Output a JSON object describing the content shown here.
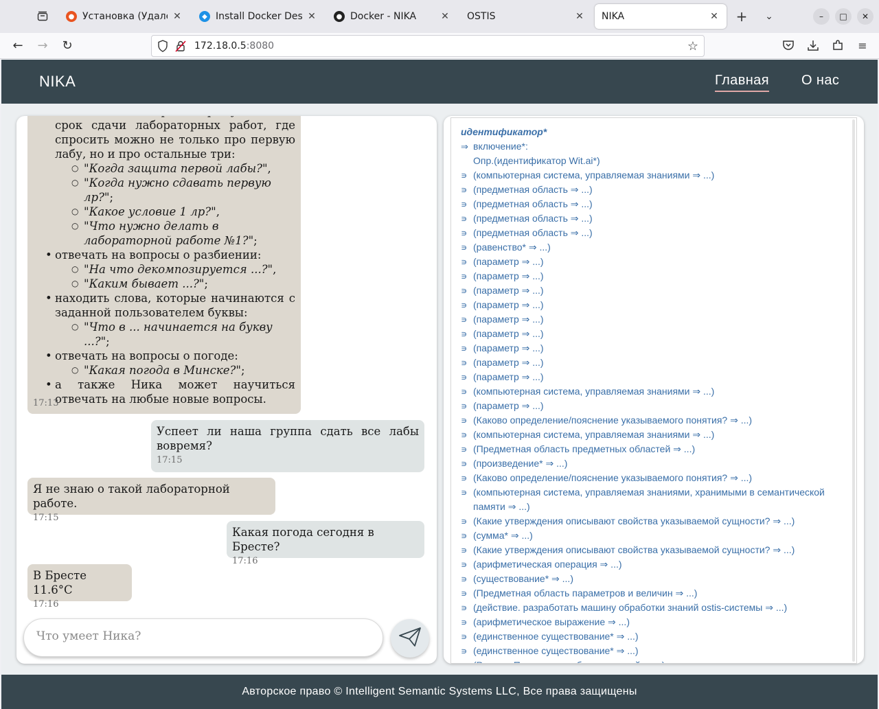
{
  "browser": {
    "tabs": [
      {
        "title": "Установка (Удаленн",
        "favicon": "ubuntu-icon",
        "active": false
      },
      {
        "title": "Install Docker Deskt",
        "favicon": "docker-icon",
        "active": false
      },
      {
        "title": "Docker - NIKA",
        "favicon": "github-icon",
        "active": false
      },
      {
        "title": "OSTIS",
        "favicon": "none",
        "active": false
      },
      {
        "title": "NIKA",
        "favicon": "none",
        "active": true
      }
    ],
    "url_host": "172.18.0.5",
    "url_port": ":8080"
  },
  "site": {
    "brand": "NIKA",
    "nav": {
      "home": "Главная",
      "about": "О нас"
    },
    "footer": "Авторское право © Intelligent Semantic Systems LLC, Все права защищены"
  },
  "chat": {
    "big_message": {
      "items": [
        {
          "level": 1,
          "text": "отвечать на вопросы про условия и срок сдачи лабораторных работ, где спросить можно не только про первую лабу, но и про остальные три:"
        },
        {
          "level": 2,
          "text": "\"Когда защита первой лабы?\"",
          "tail": ","
        },
        {
          "level": 2,
          "text": "\"Когда нужно сдавать первую лр?\"",
          "tail": ";"
        },
        {
          "level": 2,
          "text": "\"Какое условие 1 лр?\"",
          "tail": ","
        },
        {
          "level": 2,
          "text": "\"Что нужно делать в лабораторной работе №1?\"",
          "tail": ";"
        },
        {
          "level": 1,
          "text": "отвечать на вопросы о разбиении:"
        },
        {
          "level": 2,
          "text": "\"На что декомпозируется ...?\"",
          "tail": ","
        },
        {
          "level": 2,
          "text": "\"Каким бывает ...?\"",
          "tail": ";"
        },
        {
          "level": 1,
          "text": "находить слова, которые начинаются с заданной пользователем буквы:"
        },
        {
          "level": 2,
          "text": "\"Что в ... начинается на букву ...?\"",
          "tail": ";"
        },
        {
          "level": 1,
          "text": "отвечать на вопросы о погоде:"
        },
        {
          "level": 2,
          "text": "\"Какая погода в Минске?\"",
          "tail": ";"
        },
        {
          "level": 1,
          "text": "а также Ника может научиться отвечать на любые новые вопросы."
        }
      ],
      "time": "17:13"
    },
    "messages": [
      {
        "from": "user",
        "text": "Успеет ли наша группа сдать все лабы вовремя?",
        "time": "17:15"
      },
      {
        "from": "bot",
        "text": "Я не знаю о такой лабораторной работе.",
        "time": "17:15"
      },
      {
        "from": "user",
        "text": "Какая погода сегодня в Бресте?",
        "time": "17:16"
      },
      {
        "from": "bot",
        "text": "В Бресте 11.6°C",
        "time": "17:16"
      }
    ],
    "input_placeholder": "Что умеет Ника?"
  },
  "kb": {
    "title": "идентификатор*",
    "rows": [
      {
        "arrow": "⇒",
        "text": "включение*:"
      },
      {
        "arrow": "",
        "text": "Опр.(идентификатор Wit.ai*)"
      },
      {
        "arrow": "∍",
        "text": "(компьютерная система, управляемая знаниями ⇒ ...)"
      },
      {
        "arrow": "∍",
        "text": "(предметная область ⇒ ...)"
      },
      {
        "arrow": "∍",
        "text": "(предметная область ⇒ ...)"
      },
      {
        "arrow": "∍",
        "text": "(предметная область ⇒ ...)"
      },
      {
        "arrow": "∍",
        "text": "(предметная область ⇒ ...)"
      },
      {
        "arrow": "∍",
        "text": "(равенство* ⇒ ...)"
      },
      {
        "arrow": "∍",
        "text": "(параметр ⇒ ...)"
      },
      {
        "arrow": "∍",
        "text": "(параметр ⇒ ...)"
      },
      {
        "arrow": "∍",
        "text": "(параметр ⇒ ...)"
      },
      {
        "arrow": "∍",
        "text": "(параметр ⇒ ...)"
      },
      {
        "arrow": "∍",
        "text": "(параметр ⇒ ...)"
      },
      {
        "arrow": "∍",
        "text": "(параметр ⇒ ...)"
      },
      {
        "arrow": "∍",
        "text": "(параметр ⇒ ...)"
      },
      {
        "arrow": "∍",
        "text": "(параметр ⇒ ...)"
      },
      {
        "arrow": "∍",
        "text": "(параметр ⇒ ...)"
      },
      {
        "arrow": "∍",
        "text": "(компьютерная система, управляемая знаниями ⇒ ...)"
      },
      {
        "arrow": "∍",
        "text": "(параметр ⇒ ...)"
      },
      {
        "arrow": "∍",
        "text": "(Каково определение/пояснение указываемого понятия? ⇒ ...)"
      },
      {
        "arrow": "∍",
        "text": "(компьютерная система, управляемая знаниями ⇒ ...)"
      },
      {
        "arrow": "∍",
        "text": "(Предметная область предметных областей ⇒ ...)"
      },
      {
        "arrow": "∍",
        "text": "(произведение* ⇒ ...)"
      },
      {
        "arrow": "∍",
        "text": "(Каково определение/пояснение указываемого понятия? ⇒ ...)"
      },
      {
        "arrow": "∍",
        "text": "(компьютерная система, управляемая знаниями, хранимыми в семантической"
      },
      {
        "arrow": "",
        "text": "памяти ⇒ ...)"
      },
      {
        "arrow": "∍",
        "text": "(Какие утверждения описывают свойства указываемой сущности? ⇒ ...)"
      },
      {
        "arrow": "∍",
        "text": "(сумма* ⇒ ...)"
      },
      {
        "arrow": "∍",
        "text": "(Какие утверждения описывают свойства указываемой сущности? ⇒ ...)"
      },
      {
        "arrow": "∍",
        "text": "(арифметическая операция ⇒ ...)"
      },
      {
        "arrow": "∍",
        "text": "(существование* ⇒ ...)"
      },
      {
        "arrow": "∍",
        "text": "(Предметная область параметров и величин ⇒ ...)"
      },
      {
        "arrow": "∍",
        "text": "(действие. разработать машину обработки знаний ostis-системы ⇒ ...)"
      },
      {
        "arrow": "∍",
        "text": "(арифметическое выражение ⇒ ...)"
      },
      {
        "arrow": "∍",
        "text": "(единственное существование* ⇒ ...)"
      },
      {
        "arrow": "∍",
        "text": "(единственное существование* ⇒ ...)"
      },
      {
        "arrow": "∍",
        "text": "(Раздел. Предметная область знаний ⇒ ...)"
      }
    ]
  },
  "colors": {
    "header_bg": "#37474f",
    "bot_bubble": "#ddd8cf",
    "user_bubble": "#dfe4e4",
    "kb_link": "#3a6fa8"
  }
}
